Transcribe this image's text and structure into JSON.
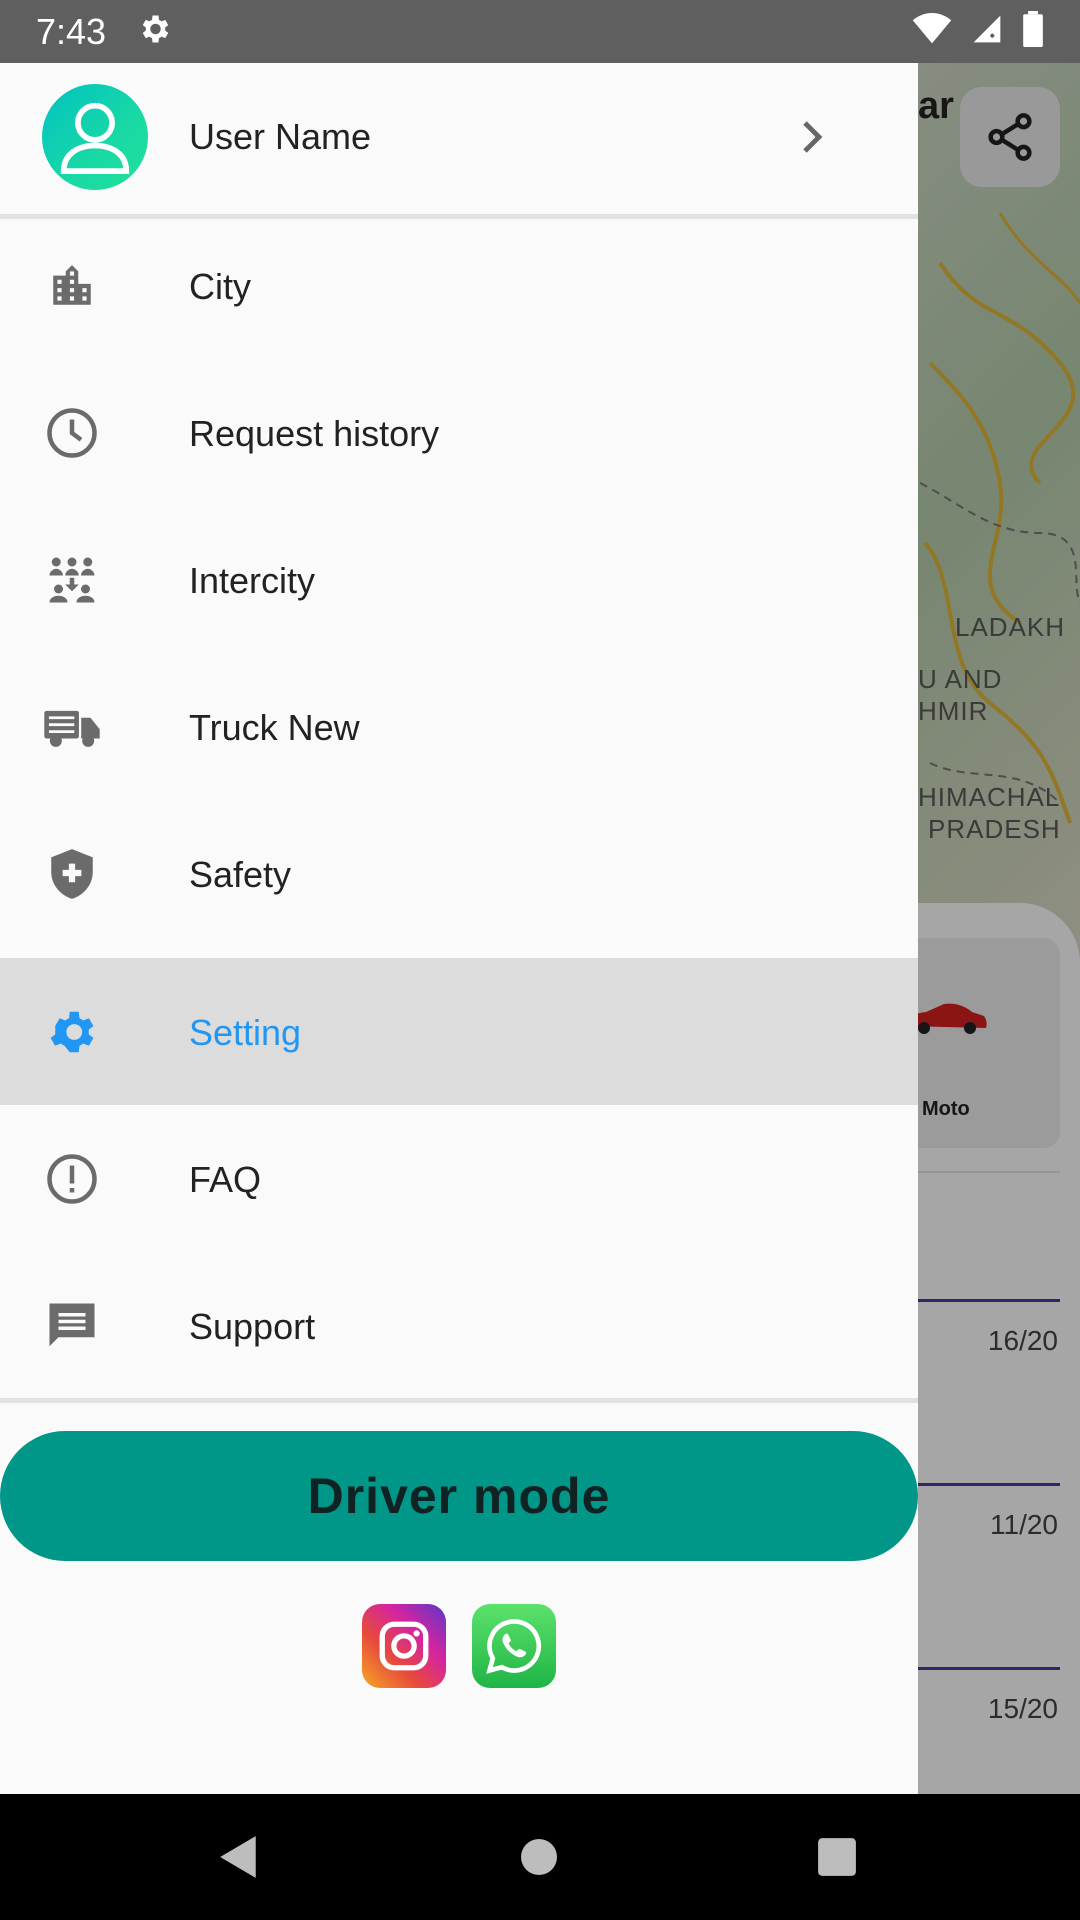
{
  "status_bar": {
    "time": "7:43",
    "icons": [
      "settings-icon",
      "wifi-icon",
      "signal-icon",
      "battery-icon"
    ]
  },
  "drawer": {
    "profile": {
      "name": "User Name",
      "avatar_icon": "person-icon"
    },
    "menu": [
      {
        "label": "City",
        "icon": "city-icon",
        "active": false
      },
      {
        "label": "Request history",
        "icon": "clock-icon",
        "active": false
      },
      {
        "label": "Intercity",
        "icon": "group-icon",
        "active": false
      },
      {
        "label": "Truck New",
        "icon": "truck-icon",
        "active": false
      },
      {
        "label": "Safety",
        "icon": "shield-icon",
        "active": false
      },
      {
        "label": "Setting",
        "icon": "gear-icon",
        "active": true
      },
      {
        "label": "FAQ",
        "icon": "alert-circle-icon",
        "active": false
      },
      {
        "label": "Support",
        "icon": "chat-icon",
        "active": false
      }
    ],
    "driver_mode_label": "Driver mode",
    "social": [
      "instagram-icon",
      "whatsapp-icon"
    ]
  },
  "background": {
    "top_fragment": "ar",
    "map_labels": {
      "ladakh": "LADAKH",
      "kashmir_1": "U AND",
      "kashmir_2": "HMIR",
      "himachal_1": "HIMACHAL",
      "himachal_2": "PRADESH"
    },
    "vehicle_label": "Moto",
    "rates": [
      "16/20",
      "11/20",
      "15/20"
    ]
  },
  "colors": {
    "accent": "#2196f3",
    "driver_button": "#009688",
    "active_row": "#dcdcdc",
    "icon_gray": "#6b6b6b"
  }
}
